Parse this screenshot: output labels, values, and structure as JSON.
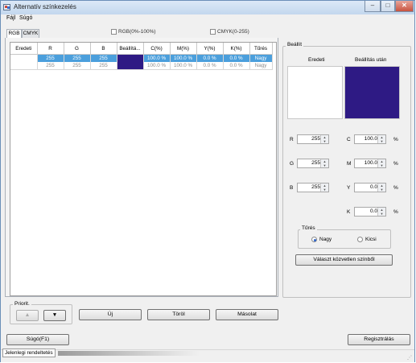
{
  "window": {
    "title": "Alternatív színkezelés",
    "minimize": "–",
    "maximize": "□",
    "close": "✕"
  },
  "menu": [
    "Fájl",
    "Súgó"
  ],
  "tabs": [
    "RGB",
    "CMYK"
  ],
  "options": {
    "rgb_percent": "RGB(0%-100%)",
    "cmyk_range": "CMYK(0-255)"
  },
  "table": {
    "columns": [
      "Eredeti",
      "R",
      "G",
      "B",
      "Beállítá...",
      "C(%)",
      "M(%)",
      "Y(%)",
      "K(%)",
      "Tűrés"
    ],
    "rows": [
      [
        "",
        "255",
        "255",
        "255",
        "",
        "100.0 %",
        "100.0 %",
        "0.0 %",
        "0.0 %",
        "Nagy"
      ],
      [
        "",
        "255",
        "255",
        "255",
        "",
        "100.0 %",
        "100.0 %",
        "0.0 %",
        "0.0 %",
        "Nagy"
      ]
    ]
  },
  "priority": {
    "label": "Priorit.",
    "up": "▲",
    "down": "▼"
  },
  "buttons": {
    "new": "Új",
    "delete": "Töröl",
    "copy": "Másolat",
    "help": "Súgó(F1)",
    "register": "Regisztrálás"
  },
  "settings": {
    "label": "Beállít",
    "original": "Eredeti",
    "after": "Beállítás után",
    "colors": {
      "original": "#ffffff",
      "after": "#2e1a84",
      "selection": "#4b9fdc"
    },
    "R": "255",
    "G": "255",
    "B": "255",
    "C": "100.0",
    "M": "100.0",
    "Y": "0.0",
    "K": "0.0",
    "percent": "%",
    "tolerance": {
      "label": "Tűrés",
      "large": "Nagy",
      "small": "Kicsi",
      "selected": "Nagy"
    },
    "pick_button": "Választ közvetlen színből"
  },
  "status": {
    "text": "Jelenlegi rendeltetés"
  }
}
